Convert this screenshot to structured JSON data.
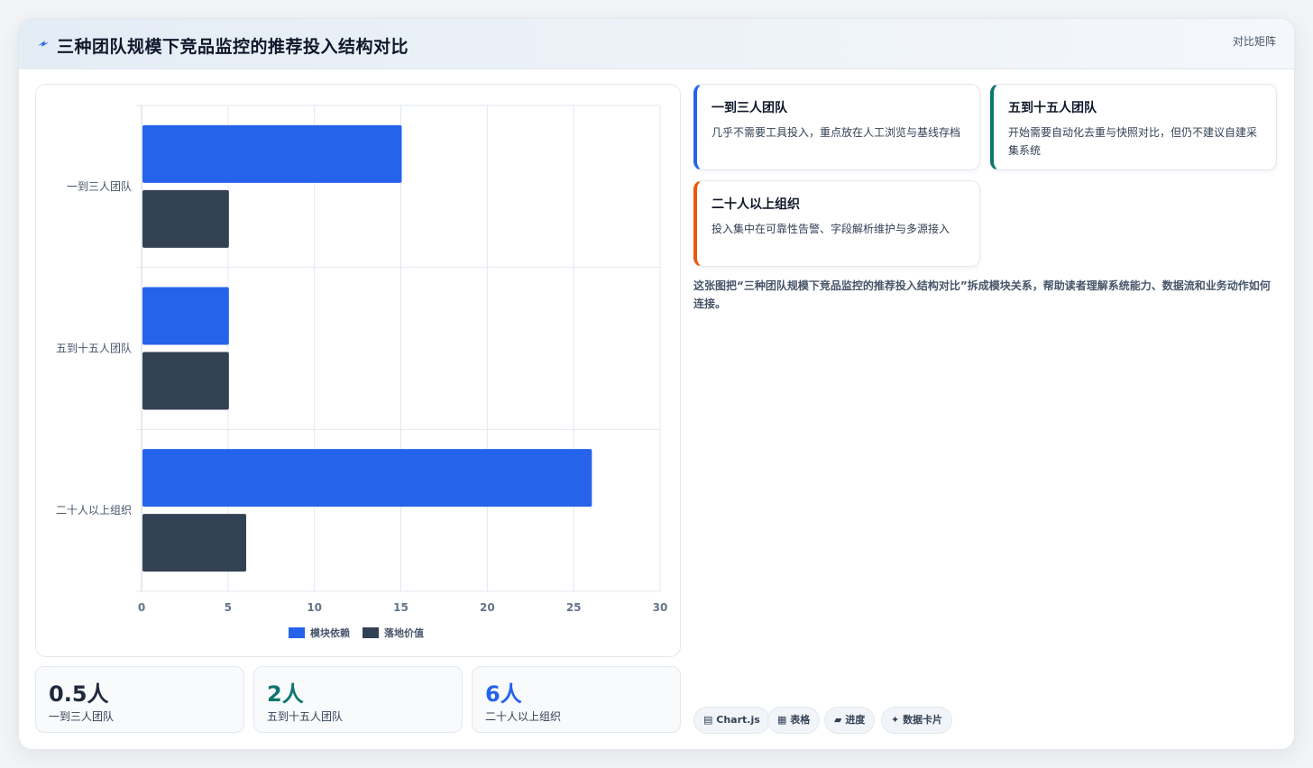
{
  "header": {
    "title": "三种团队规模下竞品监控的推荐投入结构对比",
    "tag": "对比矩阵"
  },
  "chart_data": {
    "type": "bar",
    "orientation": "horizontal",
    "categories": [
      "一到三人团队",
      "五到十五人团队",
      "二十人以上组织"
    ],
    "series": [
      {
        "name": "模块依赖",
        "values": [
          15,
          5,
          26
        ],
        "color": "#2563eb"
      },
      {
        "name": "落地价值",
        "values": [
          5,
          5,
          6
        ],
        "color": "#334155"
      }
    ],
    "xlim": [
      0,
      30
    ],
    "xticks": [
      0,
      5,
      10,
      15,
      20,
      25,
      30
    ],
    "grid": true,
    "legend": "bottom"
  },
  "stats": [
    {
      "value": "0.5人",
      "label": "一到三人团队",
      "color": "#1e293b"
    },
    {
      "value": "2人",
      "label": "五到十五人团队",
      "color": "#0f766e"
    },
    {
      "value": "6人",
      "label": "二十人以上组织",
      "color": "#2563eb"
    }
  ],
  "notes": [
    {
      "title": "一到三人团队",
      "desc": "几乎不需要工具投入，重点放在人工浏览与基线存档",
      "color": "#2563eb"
    },
    {
      "title": "五到十五人团队",
      "desc": "开始需要自动化去重与快照对比，但仍不建议自建采集系统",
      "color": "#0f766e"
    },
    {
      "title": "二十人以上组织",
      "desc": "投入集中在可靠性告警、字段解析维护与多源接入",
      "color": "#ea580c"
    }
  ],
  "description": "这张图把“三种团队规模下竞品监控的推荐投入结构对比”拆成模块关系，帮助读者理解系统能力、数据流和业务动作如何连接。",
  "chips": [
    {
      "icon": "▤",
      "label": "Chart.js"
    },
    {
      "icon": "▦",
      "label": "表格"
    },
    {
      "icon": "▰",
      "label": "进度"
    },
    {
      "icon": "✦",
      "label": "数据卡片"
    }
  ]
}
